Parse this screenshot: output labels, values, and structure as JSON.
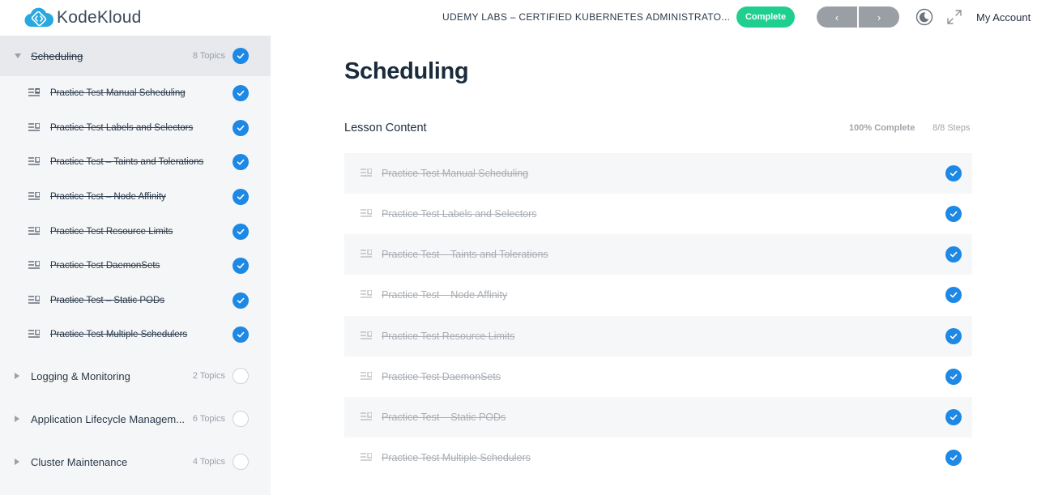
{
  "header": {
    "logo_text": "KodeKloud",
    "course_title": "UDEMY LABS – CERTIFIED KUBERNETES ADMINISTRATO...",
    "complete_label": "Complete",
    "prev_symbol": "‹",
    "next_symbol": "›",
    "account_label": "My Account"
  },
  "colors": {
    "brand": "#29a8e0",
    "complete_green": "#1fcf8f",
    "check_blue": "#1e88e5",
    "nav_gray": "#9a9fa6"
  },
  "sidebar": {
    "sections": [
      {
        "title": "Scheduling",
        "count": "8 Topics",
        "expanded": true,
        "completed": true,
        "topics": [
          "Practice Test Manual Scheduling",
          "Practice Test Labels and Selectors",
          "Practice Test – Taints and Tolerations",
          "Practice Test – Node Affinity",
          "Practice Test Resource Limits",
          "Practice Test DaemonSets",
          "Practice Test – Static PODs",
          "Practice Test Multiple Schedulers"
        ]
      },
      {
        "title": "Logging & Monitoring",
        "count": "2 Topics",
        "expanded": false,
        "completed": false
      },
      {
        "title": "Application Lifecycle Managem...",
        "count": "6 Topics",
        "expanded": false,
        "completed": false
      },
      {
        "title": "Cluster Maintenance",
        "count": "4 Topics",
        "expanded": false,
        "completed": false
      }
    ]
  },
  "main": {
    "title": "Scheduling",
    "lesson_label": "Lesson Content",
    "progress": "100% Complete",
    "steps": "8/8 Steps",
    "items": [
      "Practice Test Manual Scheduling",
      "Practice Test Labels and Selectors",
      "Practice Test – Taints and Tolerations",
      "Practice Test – Node Affinity",
      "Practice Test Resource Limits",
      "Practice Test DaemonSets",
      "Practice Test – Static PODs",
      "Practice Test Multiple Schedulers"
    ]
  }
}
